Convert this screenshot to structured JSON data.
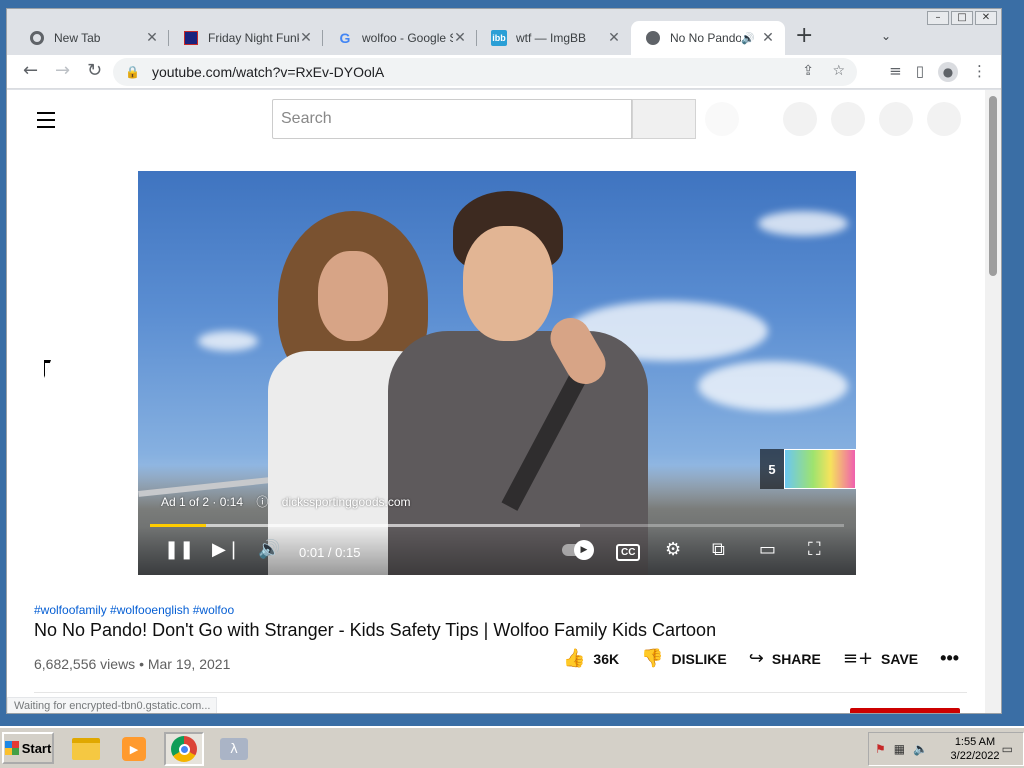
{
  "tabs": [
    {
      "title": "New Tab",
      "icon": "chrome-icon"
    },
    {
      "title": "Friday Night Funki",
      "icon": "fnf-icon"
    },
    {
      "title": "wolfoo - Google S",
      "icon": "google-icon"
    },
    {
      "title": "wtf — ImgBB",
      "icon": "imgbb-icon"
    },
    {
      "title": "No No Pando",
      "icon": "globe-icon",
      "active": true,
      "audio": true
    }
  ],
  "address_bar": {
    "url": "youtube.com/watch?v=RxEv-DYOolA"
  },
  "youtube": {
    "search_placeholder": "Search",
    "player": {
      "ad_label": "Ad 1 of 2 · 0:14",
      "ad_domain": "dickssportinggoods.com",
      "skip_count": "5",
      "time": "0:01 / 0:15",
      "progress_fraction": 0.08,
      "buffered_fraction": 0.62
    },
    "hashtags": "#wolfoofamily #wolfooenglish #wolfoo",
    "title": "No No Pando! Don't Go with Stranger - Kids Safety Tips | Wolfoo Family Kids Cartoon",
    "meta": "6,682,556 views • Mar 19, 2021",
    "actions": {
      "like": "36K",
      "dislike": "DISLIKE",
      "share": "SHARE",
      "save": "SAVE"
    },
    "status_text": "Waiting for encrypted-tbn0.gstatic.com..."
  },
  "taskbar": {
    "start_label": "Start",
    "clock_time": "1:55 AM",
    "clock_date": "3/22/2022"
  },
  "colors": {
    "link_blue": "#065fd4",
    "progress_yellow": "#ffcc00",
    "taskbar_gray": "#d4d0c8",
    "desktop_blue": "#3a6ea5"
  }
}
